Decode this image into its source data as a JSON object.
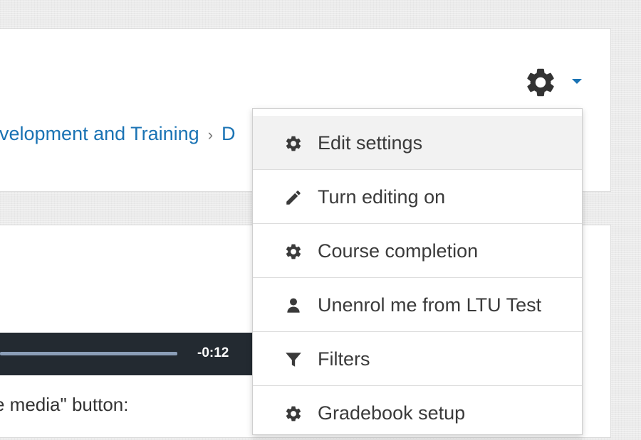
{
  "header": {
    "breadcrumb": [
      {
        "label": "evelopment and Training"
      },
      {
        "label": "D"
      }
    ],
    "breadcrumb_separator": "›"
  },
  "media": {
    "time": "-0:12",
    "progress": 0.7
  },
  "content": {
    "instruction": "e media\" button:"
  },
  "menu": {
    "items": [
      {
        "label": "Edit settings",
        "icon": "gear-icon",
        "active": true
      },
      {
        "label": "Turn editing on",
        "icon": "pencil-icon",
        "active": false
      },
      {
        "label": "Course completion",
        "icon": "gear-icon",
        "active": false
      },
      {
        "label": "Unenrol me from LTU Test",
        "icon": "user-icon",
        "active": false
      },
      {
        "label": "Filters",
        "icon": "filter-icon",
        "active": false
      },
      {
        "label": "Gradebook setup",
        "icon": "gear-icon",
        "active": false
      }
    ]
  },
  "colors": {
    "link": "#1a73b4",
    "icon": "#3a3a3a",
    "active_item_bg": "#f2f2f2",
    "player_bg": "#232a31",
    "caret": "#1a73b4"
  }
}
